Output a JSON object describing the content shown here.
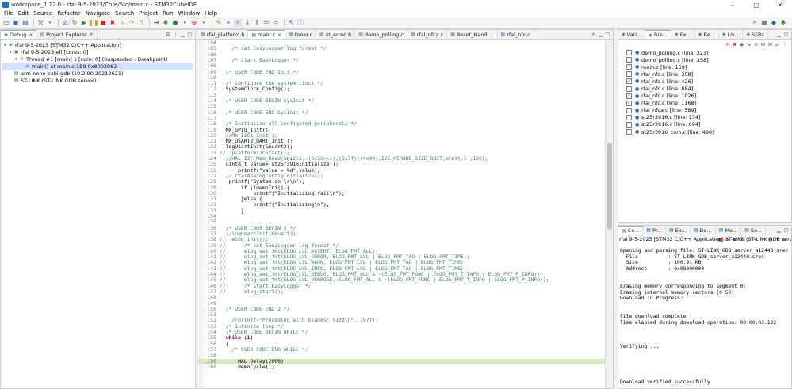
{
  "window": {
    "title": "workspace_1.12.0 - rfal 9-5-2023/Core/Src/main.c - STM32CubeIDE",
    "minimize": "–",
    "maximize": "□",
    "close": "✕"
  },
  "menu": [
    "File",
    "Edit",
    "Source",
    "Refactor",
    "Navigate",
    "Search",
    "Project",
    "Run",
    "Window",
    "Help"
  ],
  "debug_panel": {
    "tabs": [
      {
        "label": "Debug",
        "close": "✕"
      },
      {
        "label": "Project Explorer",
        "close": "✕"
      }
    ],
    "tree": [
      {
        "indent": 0,
        "arrow": "▾",
        "icon": "◈",
        "label": "rfal 9-5-2023 [STM32 C/C++ Application]",
        "sel": false
      },
      {
        "indent": 1,
        "arrow": "▾",
        "icon": "▣",
        "label": "rfal 9-5-2023.elf [cores: 0]",
        "sel": false
      },
      {
        "indent": 2,
        "arrow": "▾",
        "icon": "⚙",
        "label": "Thread #1 [main] 1 [core: 0] (Suspended : Breakpoint)",
        "sel": false
      },
      {
        "indent": 3,
        "arrow": "",
        "icon": "≡",
        "label": "main() at main.c:159 0x8002982",
        "sel": true
      },
      {
        "indent": 1,
        "arrow": "",
        "icon": "▤",
        "label": "arm-none-eabi-gdb (10.2.90.20210621)",
        "sel": false
      },
      {
        "indent": 1,
        "arrow": "",
        "icon": "▤",
        "label": "ST-LINK (ST-LINK GDB server)",
        "sel": false
      }
    ]
  },
  "editor": {
    "tabs": [
      {
        "label": "rfal_platform.h",
        "active": false
      },
      {
        "label": "main.c",
        "active": true,
        "close": "✕"
      },
      {
        "label": "timer.c",
        "active": false
      },
      {
        "label": "st_errno.h",
        "active": false
      },
      {
        "label": "demo_polling.c",
        "active": false
      },
      {
        "label": "rfal_nfca.c",
        "active": false
      },
      {
        "label": "Reset_Handl...",
        "active": false
      },
      {
        "label": "rfal_nfc.c",
        "active": false
      }
    ],
    "overflow": "»",
    "lines": [
      {
        "n": "104",
        "t": "",
        "c": "cd"
      },
      {
        "n": "105",
        "t": "    /* set EasyLogger log format */",
        "c": "cm"
      },
      {
        "n": "106",
        "t": "",
        "c": "cd"
      },
      {
        "n": "107",
        "t": "    /* start EasyLogger */",
        "c": "cm"
      },
      {
        "n": "108",
        "t": "",
        "c": "cd"
      },
      {
        "n": "109",
        "t": "  /* USER CODE END Init */",
        "c": "cm"
      },
      {
        "n": "110",
        "t": "",
        "c": "cd"
      },
      {
        "n": "111",
        "t": "  /* Configure the system clock */",
        "c": "cm"
      },
      {
        "n": "112",
        "t": "  SystemClock_Config();",
        "c": "cd"
      },
      {
        "n": "113",
        "t": "",
        "c": "cd"
      },
      {
        "n": "114",
        "t": "  /* USER CODE BEGIN SysInit */",
        "c": "cm"
      },
      {
        "n": "115",
        "t": "",
        "c": "cd"
      },
      {
        "n": "116",
        "t": "  /* USER CODE END SysInit */",
        "c": "cm"
      },
      {
        "n": "117",
        "t": "",
        "c": "cd"
      },
      {
        "n": "118",
        "t": "  /* Initialize all configured peripherals */",
        "c": "cm"
      },
      {
        "n": "119",
        "t": "  MX_GPIO_Init();",
        "c": "cd"
      },
      {
        "n": "120",
        "t": "  //MX_I2C1_Init();",
        "c": "cm"
      },
      {
        "n": "121",
        "t": "  MX_USART2_UART_Init();",
        "c": "cd"
      },
      {
        "n": "122",
        "t": "  logUsartInit(&huart2);",
        "c": "cd"
      },
      {
        "n": "123",
        "t": "//  platformI2CStart();",
        "c": "cm"
      },
      {
        "n": "124",
        "t": "  //HAL_I2C_Mem_Read(&hi2c1, (0x50<<1),(0x3f)|(0x40),I2C_MEMADD_SIZE_8BIT,&test,1 ,100);",
        "c": "cm"
      },
      {
        "n": "125",
        "t": "  uint8_t value= st25r3916Initialize();",
        "c": "cd"
      },
      {
        "n": "126",
        "t": "      printf(\"value = %d\",value);",
        "c": "cd"
      },
      {
        "n": "127",
        "t": "  // rfalAnalogConfigInitialize();",
        "c": "cm"
      },
      {
        "n": "128",
        "t": "   printf(\"System on \\r\\n\");",
        "c": "cd"
      },
      {
        "n": "129",
        "t": "       if (!demoIni()){",
        "c": "cd"
      },
      {
        "n": "130",
        "t": "           printf(\"Initializing fail\\n\");",
        "c": "cd"
      },
      {
        "n": "131",
        "t": "       }else {",
        "c": "cd"
      },
      {
        "n": "132",
        "t": "           printf(\"Initializing\\n\");",
        "c": "cd"
      },
      {
        "n": "133",
        "t": "       }",
        "c": "cd"
      },
      {
        "n": "134",
        "t": "",
        "c": "cd"
      },
      {
        "n": "135",
        "t": "",
        "c": "cd"
      },
      {
        "n": "136",
        "t": "  /* USER CODE BEGIN 2 */",
        "c": "cm"
      },
      {
        "n": "137",
        "t": "  //logUsartInit(&huart2);",
        "c": "cm"
      },
      {
        "n": "138",
        "t": "//  elog_init();",
        "c": "cm"
      },
      {
        "n": "139",
        "t": "//      /* set EasyLogger log format */",
        "c": "cm"
      },
      {
        "n": "140",
        "t": "//      elog_set_fmt(ELOG_LVL_ASSERT, ELOG_FMT_ALL);",
        "c": "cm"
      },
      {
        "n": "141",
        "t": "//      elog_set_fmt(ELOG_LVL_ERROR, ELOG_FMT_LVL | ELOG_FMT_TAG | ELOG_FMT_TIME);",
        "c": "cm"
      },
      {
        "n": "142",
        "t": "//      elog_set_fmt(ELOG_LVL_WARN, ELOG_FMT_LVL | ELOG_FMT_TAG | ELOG_FMT_TIME);",
        "c": "cm"
      },
      {
        "n": "143",
        "t": "//      elog_set_fmt(ELOG_LVL_INFO, ELOG_FMT_LVL | ELOG_FMT_TAG | ELOG_FMT_TIME);",
        "c": "cm"
      },
      {
        "n": "144",
        "t": "//      elog_set_fmt(ELOG_LVL_DEBUG, ELOG_FMT_ALL & ~(ELOG_FMT_FUNC | ELOG_FMT_T_INFO | ELOG_FMT_P_INFO));",
        "c": "cm"
      },
      {
        "n": "145",
        "t": "//      elog_set_fmt(ELOG_LVL_VERBOSE, ELOG_FMT_ALL & ~(ELOG_FMT_FUNC | ELOG_FMT_T_INFO | ELOG_FMT_P_INFO));",
        "c": "cm"
      },
      {
        "n": "146",
        "t": "//      /* start EasyLogger */",
        "c": "cm"
      },
      {
        "n": "147",
        "t": "//      elog_start();",
        "c": "cm"
      },
      {
        "n": "148",
        "t": "",
        "c": "cd"
      },
      {
        "n": "149",
        "t": "",
        "c": "cd"
      },
      {
        "n": "150",
        "t": "  /* USER CODE END 2 */",
        "c": "cm"
      },
      {
        "n": "151",
        "t": "",
        "c": "cd"
      },
      {
        "n": "152",
        "t": "    //printf(\"Preceding with blanks: %10d\\n\", 1977);",
        "c": "cm"
      },
      {
        "n": "153",
        "t": "  /* Infinite loop */",
        "c": "cm"
      },
      {
        "n": "154",
        "t": "  /* USER CODE BEGIN WHILE */",
        "c": "cm"
      },
      {
        "n": "155",
        "t": "  while (1)",
        "c": "kw"
      },
      {
        "n": "156",
        "t": "  {",
        "c": "cd"
      },
      {
        "n": "157",
        "t": "    /* USER CODE END WHILE */",
        "c": "cm"
      },
      {
        "n": "158",
        "t": "",
        "c": "cd"
      },
      {
        "n": "159",
        "t": "      HAL_Delay(2000);",
        "c": "cd",
        "cur": true
      },
      {
        "n": "160",
        "t": "      demoCycle();",
        "c": "cd"
      }
    ]
  },
  "breakpoints_panel": {
    "tabs": [
      "Vari...",
      "Bre...",
      "Ex...",
      "Re...",
      "Liv...",
      "SFRs"
    ],
    "items": [
      {
        "checked": false,
        "label": "demo_polling.c [line: 323]"
      },
      {
        "checked": false,
        "label": "demo_polling.c [line: 358]"
      },
      {
        "checked": true,
        "label": "main.c [line: 159]"
      },
      {
        "checked": false,
        "label": "rfal_nfc.c [line: 358]"
      },
      {
        "checked": true,
        "label": "rfal_nfc.c [line: 426]"
      },
      {
        "checked": false,
        "label": "rfal_nfc.c [line: 884]"
      },
      {
        "checked": true,
        "label": "rfal_nfc.c [line: 1026]"
      },
      {
        "checked": true,
        "label": "rfal_nfc.c [line: 1168]"
      },
      {
        "checked": false,
        "label": "rfal_nfca.c [line: 589]"
      },
      {
        "checked": false,
        "label": "st25r3916.c [line: 134]"
      },
      {
        "checked": false,
        "label": "st25r3916.c [line: 694]"
      },
      {
        "checked": false,
        "label": "st25r3916_com.c [line: 488]"
      }
    ]
  },
  "console_panel": {
    "tabs": [
      "Co...",
      "Pr...",
      "Ex...",
      "De...",
      "Me...",
      "Se..."
    ],
    "title": "rfal 9-5-2023 [STM32 C/C++ Application] ST-LINK (ST-LINK GDB server) [pid: 652]",
    "lines": [
      "Opening and parsing file: ST-LINK_GDB_server_a12448.srec",
      "  File          : ST-LINK_GDB_server_a12448.srec",
      "  Size          : 100.91 KB",
      "  Address       : 0x08000000",
      "",
      "",
      "Erasing memory corresponding to segment 0:",
      "Erasing internal memory sectors [0 50]",
      "Download in Progress:",
      "",
      "",
      "File download complete",
      "Time elapsed during download operation: 00:00:03.132",
      "",
      "",
      "",
      "Verifying ...",
      "",
      "",
      "",
      "",
      "",
      "Download verified successfully"
    ]
  }
}
